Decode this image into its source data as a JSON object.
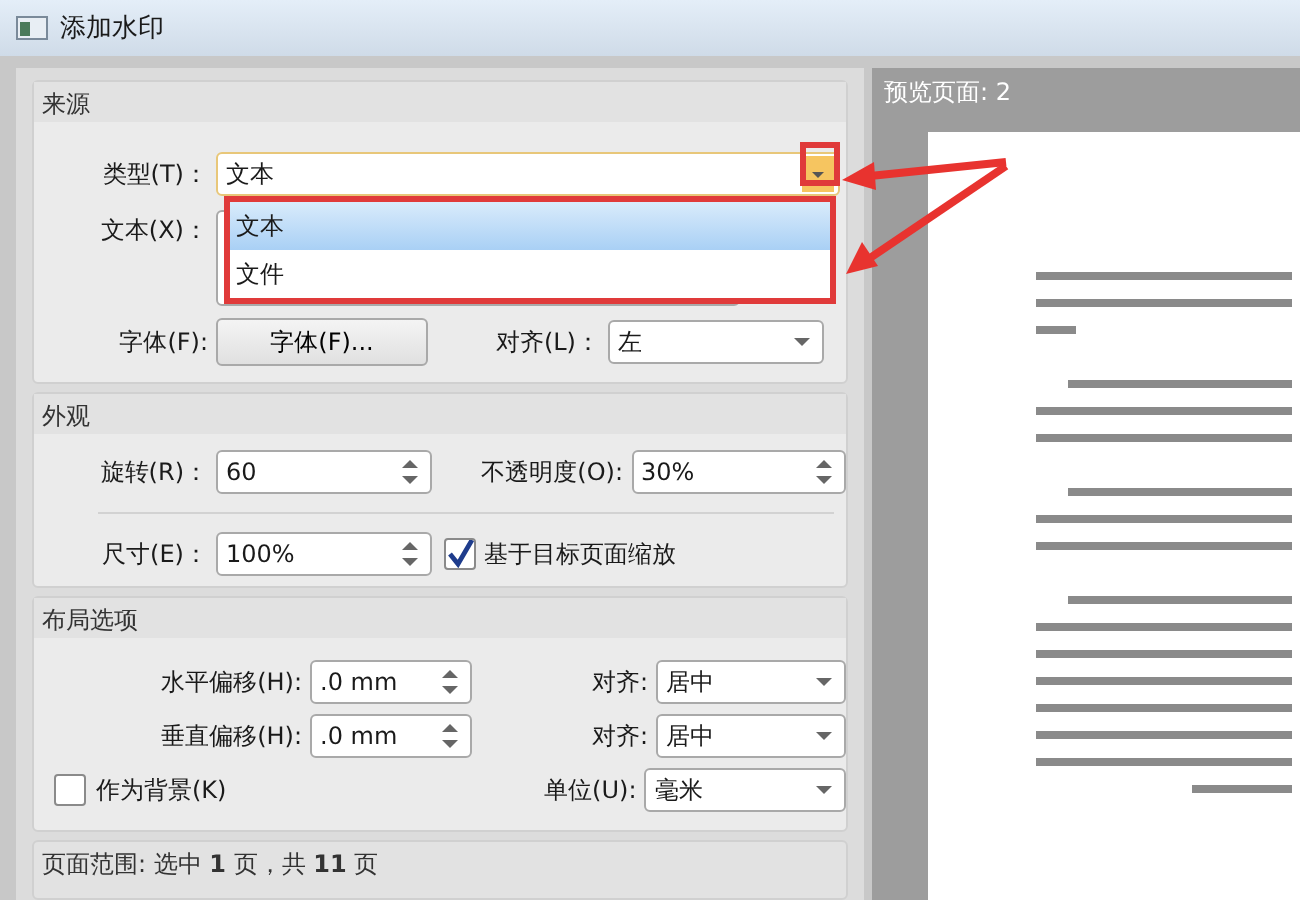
{
  "window": {
    "title": "添加水印"
  },
  "source": {
    "title": "来源",
    "type": {
      "label": "类型(T)：",
      "value": "文本",
      "expanded": true,
      "options": [
        {
          "label": "文本",
          "selected": true
        },
        {
          "label": "文件",
          "selected": false
        }
      ]
    },
    "text_label": "文本(X)：",
    "font": {
      "label": "字体(F):",
      "button": "字体(F)..."
    },
    "align": {
      "label": "对齐(L)：",
      "value": "左"
    }
  },
  "appearance": {
    "title": "外观",
    "rotation": {
      "label": "旋转(R)：",
      "value": "60"
    },
    "opacity": {
      "label": "不透明度(O):",
      "value": "30%"
    },
    "size": {
      "label": "尺寸(E)：",
      "value": "100%"
    },
    "scale": {
      "label": "基于目标页面缩放",
      "checked": true
    }
  },
  "layout": {
    "title": "布局选项",
    "horizontal": {
      "label": "水平偏移(H):",
      "value": ".0 mm",
      "align_label": "对齐:",
      "align": "居中"
    },
    "vertical": {
      "label": "垂直偏移(H):",
      "value": ".0 mm",
      "align_label": "对齐:",
      "align": "居中"
    },
    "background": {
      "label": "作为背景(K)",
      "checked": false
    },
    "unit": {
      "label": "单位(U):",
      "value": "毫米"
    }
  },
  "page_range": "页面范围: 选中 **1** 页，共 **11** 页",
  "preview": {
    "title": "预览页面: 2"
  }
}
